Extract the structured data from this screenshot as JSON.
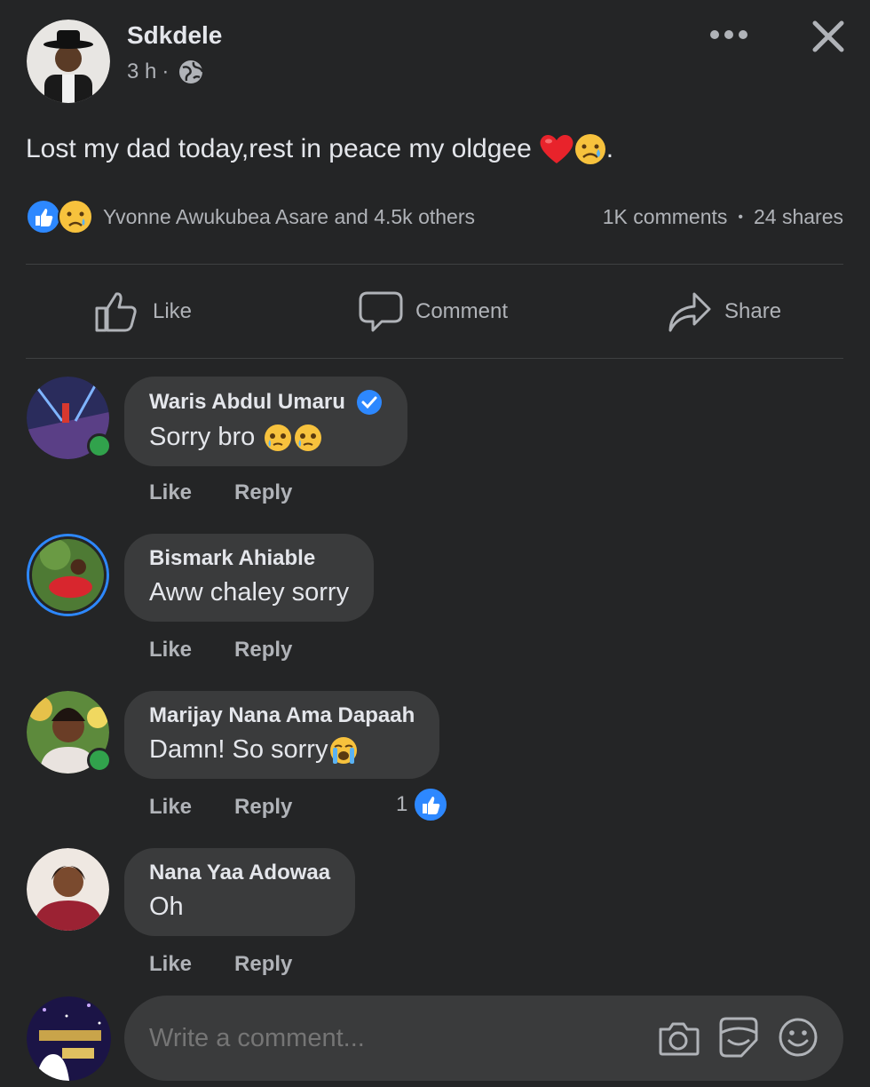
{
  "post": {
    "author": "Sdkdele",
    "time": "3 h",
    "time_sep": "·",
    "privacy_icon": "globe-icon",
    "text": "Lost my dad today,rest in peace my oldgee",
    "text_end": ".",
    "reactions_summary": "Yvonne Awukubea Asare and 4.5k others",
    "comments_count": "1K comments",
    "dot": "•",
    "shares_count": "24 shares"
  },
  "actions": {
    "like": "Like",
    "comment": "Comment",
    "share": "Share"
  },
  "comments": [
    {
      "author": "Waris Abdul Umaru",
      "verified": true,
      "text": "Sorry bro",
      "like": "Like",
      "reply": "Reply"
    },
    {
      "author": "Bismark Ahiable",
      "text": "Aww chaley sorry",
      "like": "Like",
      "reply": "Reply"
    },
    {
      "author": "Marijay Nana Ama Dapaah",
      "text": "Damn! So sorry",
      "like": "Like",
      "reply": "Reply",
      "like_count": "1"
    },
    {
      "author": "Nana Yaa Adowaa",
      "text": "Oh",
      "like": "Like",
      "reply": "Reply"
    }
  ],
  "composer": {
    "placeholder": "Write a comment...",
    "icons": [
      "camera-icon",
      "gif-sticker-icon",
      "emoji-icon"
    ]
  },
  "colors": {
    "background": "#242526",
    "bubble": "#3a3b3c",
    "accent_blue": "#2d88ff",
    "online_green": "#31a24c",
    "secondary_text": "#b0b3b8"
  }
}
